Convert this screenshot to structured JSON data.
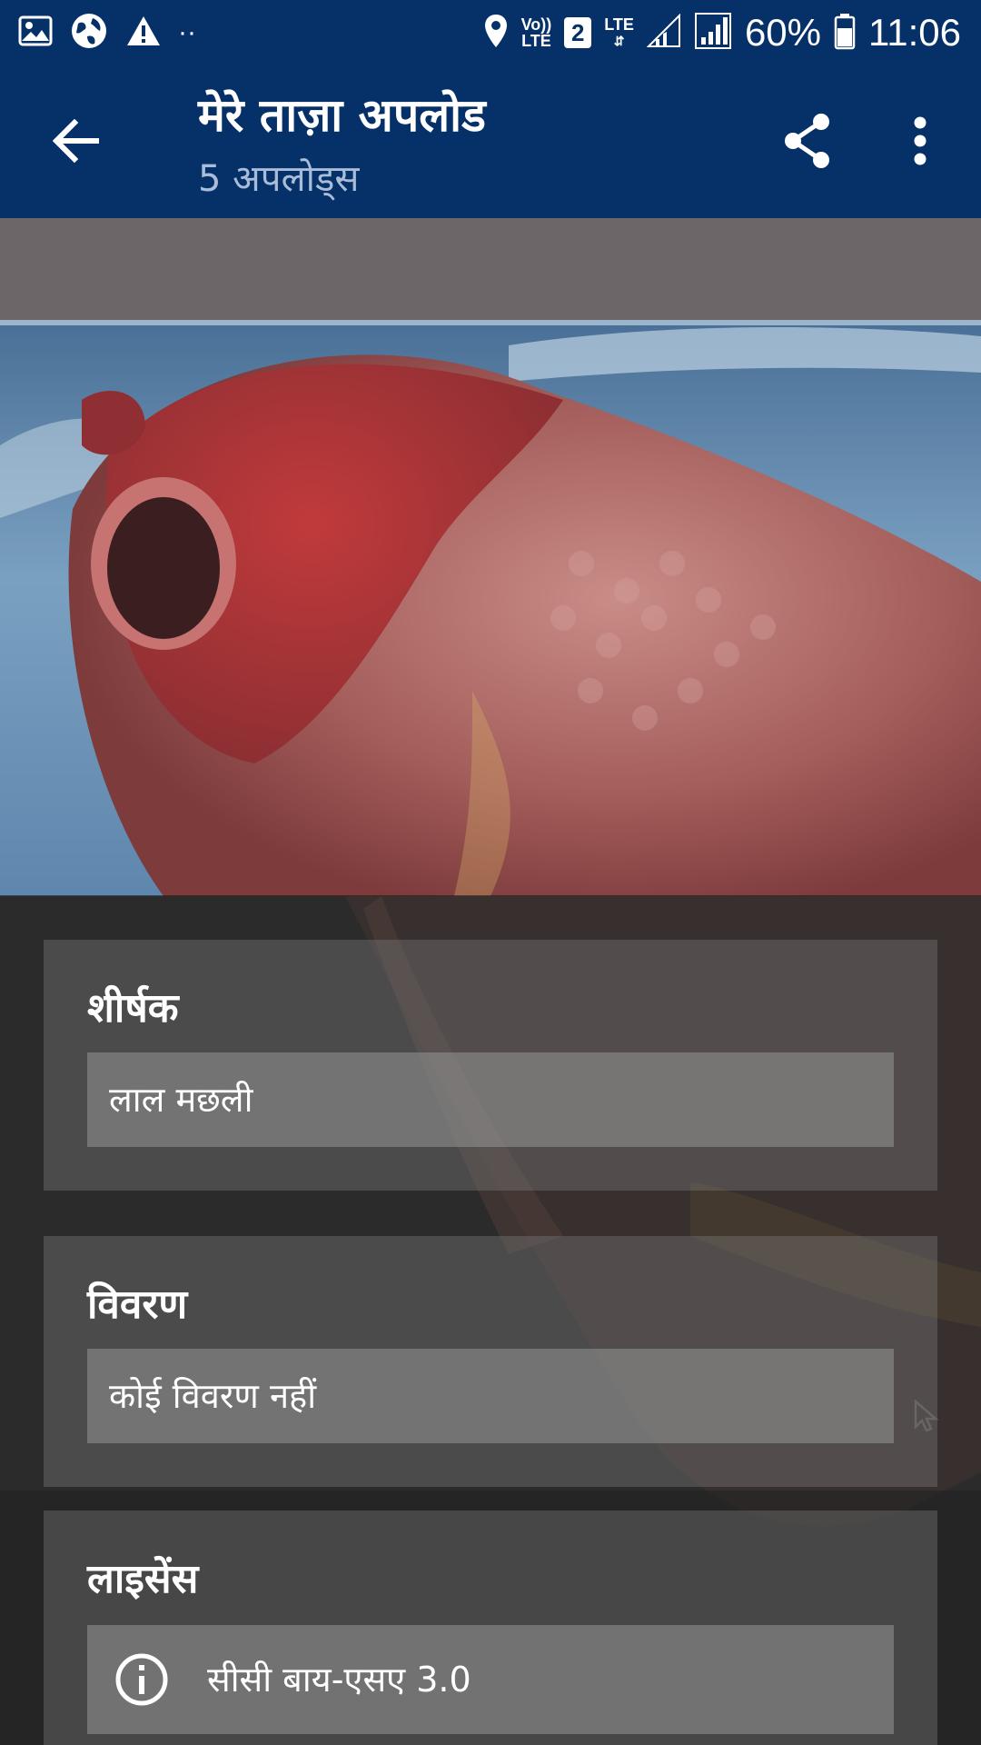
{
  "status_bar": {
    "battery": "60%",
    "time": "11:06",
    "volte_line1": "Vo))",
    "volte_line2": "LTE",
    "sim_slot": "2",
    "lte": "LTE",
    "notification_dots": "··"
  },
  "app_bar": {
    "title": "मेरे ताज़ा अपलोड",
    "subtitle": "5 अपलोड्स"
  },
  "title_card": {
    "label": "शीर्षक",
    "value": "लाल मछली"
  },
  "description_card": {
    "label": "विवरण",
    "value": "कोई विवरण नहीं"
  },
  "license_card": {
    "label": "लाइसेंस",
    "value": "सीसी बाय-एसए 3.0"
  },
  "colors": {
    "app_bar": "#053168",
    "subtitle": "#a9bcd9",
    "text": "#ffffff"
  },
  "icons": [
    "image-icon",
    "globe-icon",
    "warning-icon",
    "location-icon",
    "signal-icon",
    "battery-icon",
    "back-arrow-icon",
    "share-icon",
    "more-vertical-icon",
    "info-icon",
    "cursor-icon"
  ]
}
